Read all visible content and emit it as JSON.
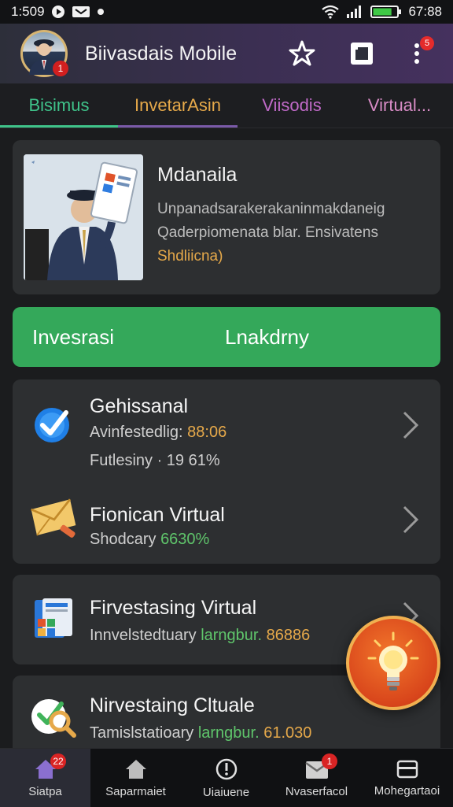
{
  "status_bar": {
    "time": "1:509",
    "right_time": "67:88",
    "battery_level": 0.8
  },
  "app": {
    "title": "Biivasdais Mobile",
    "avatar_badge": "1",
    "menu_badge": "5"
  },
  "tabs": [
    {
      "label": "Bisimus",
      "color": "#3fc38a",
      "active": true
    },
    {
      "label": "InvetarAsin",
      "color": "#e6a94a"
    },
    {
      "label": "Viisodis",
      "color": "#c06ac8"
    },
    {
      "label": "Virtual...",
      "color": "#d88cc6"
    }
  ],
  "profile": {
    "name": "Mdanaila",
    "desc_line1": "Unpanadsarakerakaninmakdaneig",
    "desc_line2": "Qaderpiomenata blar. Ensivatens",
    "link": "Shdliicna)"
  },
  "actions": {
    "primary": "Invesrasi",
    "secondary": "Lnakdrny",
    "accent": "#34a85a"
  },
  "items": [
    {
      "title": "Gehissanal",
      "sub1_label": "Avinfestedlig: ",
      "sub1_value": "88:06",
      "sub2_label": "Futlesiny · 19 61%",
      "icon": "checkmark-badge-icon"
    },
    {
      "title": "Fionican Virtual",
      "sub_label": "Shodcary ",
      "sub_value": "6630%",
      "icon": "envelope-icon"
    },
    {
      "title": "Firvestasing Virtual",
      "sub_label": "Innvelstedtuary ",
      "sub_mid": "larngbur. ",
      "sub_value": "86886",
      "icon": "document-chart-icon"
    },
    {
      "title": "Nirvestaing Cltuale",
      "sub_label": "Tamislstatioary ",
      "sub_mid": "larngbur. ",
      "sub_value": "61.030",
      "icon": "search-check-icon"
    }
  ],
  "nav": [
    {
      "label": "Siatpa",
      "badge": "22",
      "icon": "home-icon"
    },
    {
      "label": "Saparmaiet",
      "icon": "home-icon"
    },
    {
      "label": "Uiaiuene",
      "icon": "alert-icon"
    },
    {
      "label": "Nvaserfacol",
      "badge": "1",
      "icon": "mail-icon"
    },
    {
      "label": "Mohegartaoi",
      "icon": "card-icon"
    }
  ]
}
